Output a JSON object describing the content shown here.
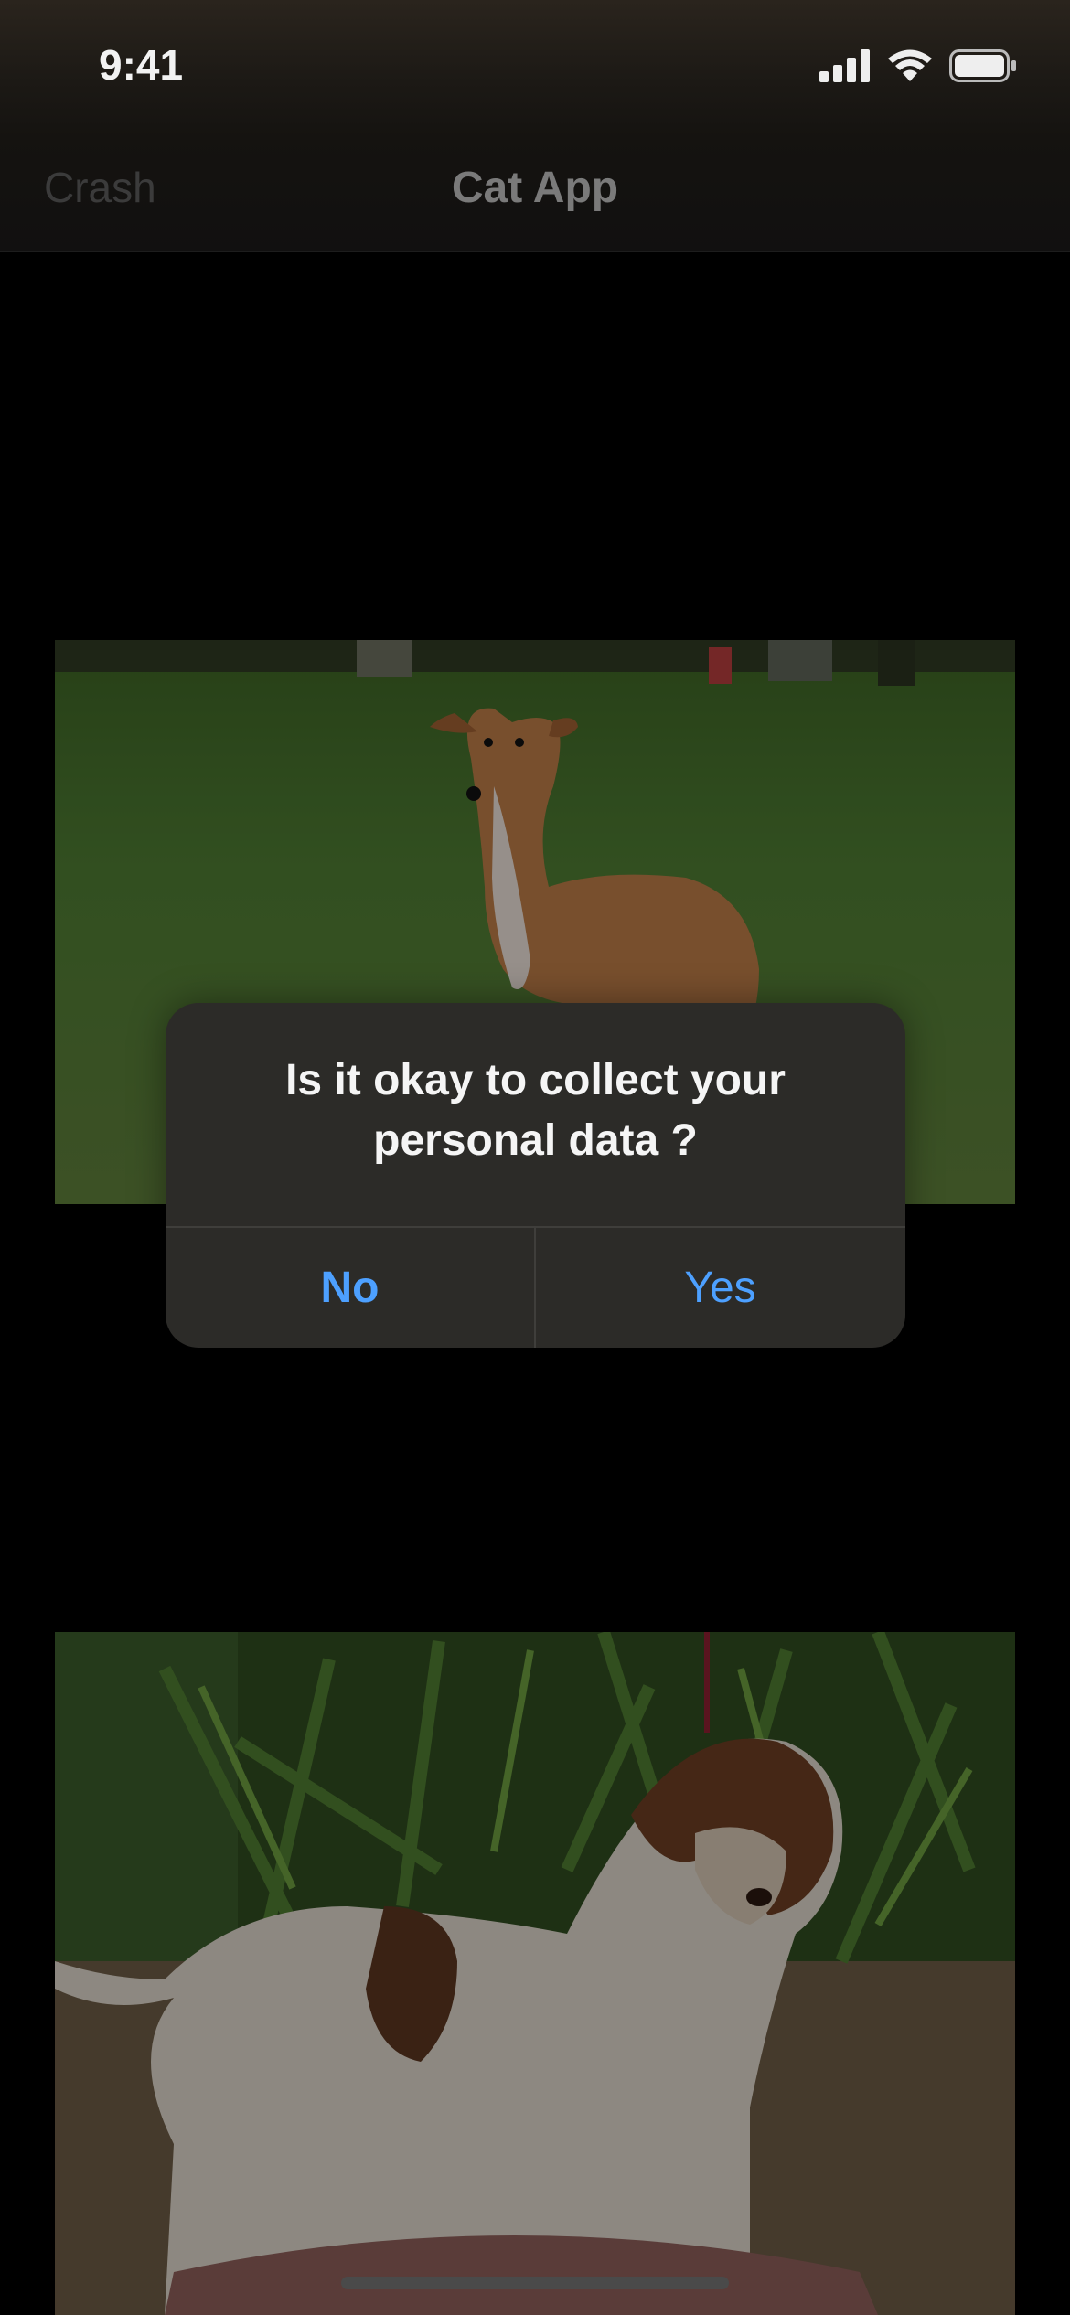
{
  "status_bar": {
    "time": "9:41"
  },
  "navbar": {
    "left_button": "Crash",
    "title": "Cat App"
  },
  "alert": {
    "message_line1": "Is it okay to collect your",
    "message_line2": "personal data ?",
    "no_label": "No",
    "yes_label": "Yes",
    "button_color": "#4da0ff"
  },
  "photos": [
    {
      "subject": "dog-photo-italian-greyhound"
    },
    {
      "subject": "dog-photo-curly-brown-white-dog"
    }
  ]
}
